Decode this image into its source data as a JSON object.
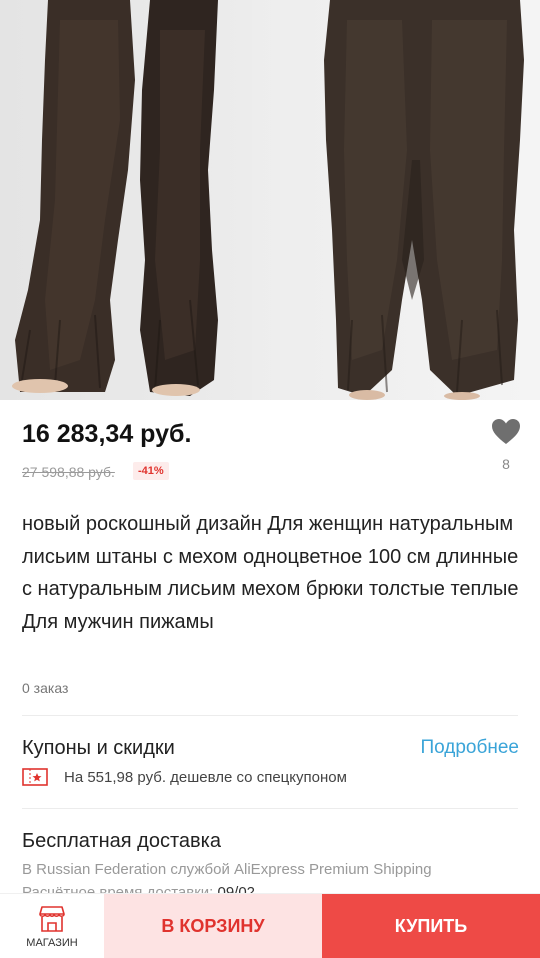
{
  "product": {
    "price": "16 283,34 руб.",
    "old_price": "27 598,88 руб.",
    "discount": "-41%",
    "wishlist_count": "8",
    "title": " новый роскошный дизайн Для женщин натуральным лисьим штаны с мехом одноцветное 100 см длинные с натуральным лисьим мехом брюки толстые теплые Для мужчин пижамы",
    "orders": "0 заказ"
  },
  "coupons": {
    "title": "Купоны и скидки",
    "more_link": "Подробнее",
    "text": "На 551,98 руб. дешевле со спецкупоном"
  },
  "delivery": {
    "title": "Бесплатная доставка",
    "line": "В Russian Federation службой AliExpress Premium Shipping",
    "time_label": "Расчётное время доставки: ",
    "time_value": "09/02"
  },
  "bottom_bar": {
    "shop_label": "МАГАЗИН",
    "cart_label": "В КОРЗИНУ",
    "buy_label": "КУПИТЬ"
  },
  "colors": {
    "accent_red": "#ee4a46",
    "cart_bg": "#fde3e3",
    "link_blue": "#3aa4d8",
    "fur_brown": "#3a2f28"
  },
  "icons": {
    "wishlist": "heart-icon",
    "coupon": "coupon-icon",
    "shop": "shop-icon"
  }
}
